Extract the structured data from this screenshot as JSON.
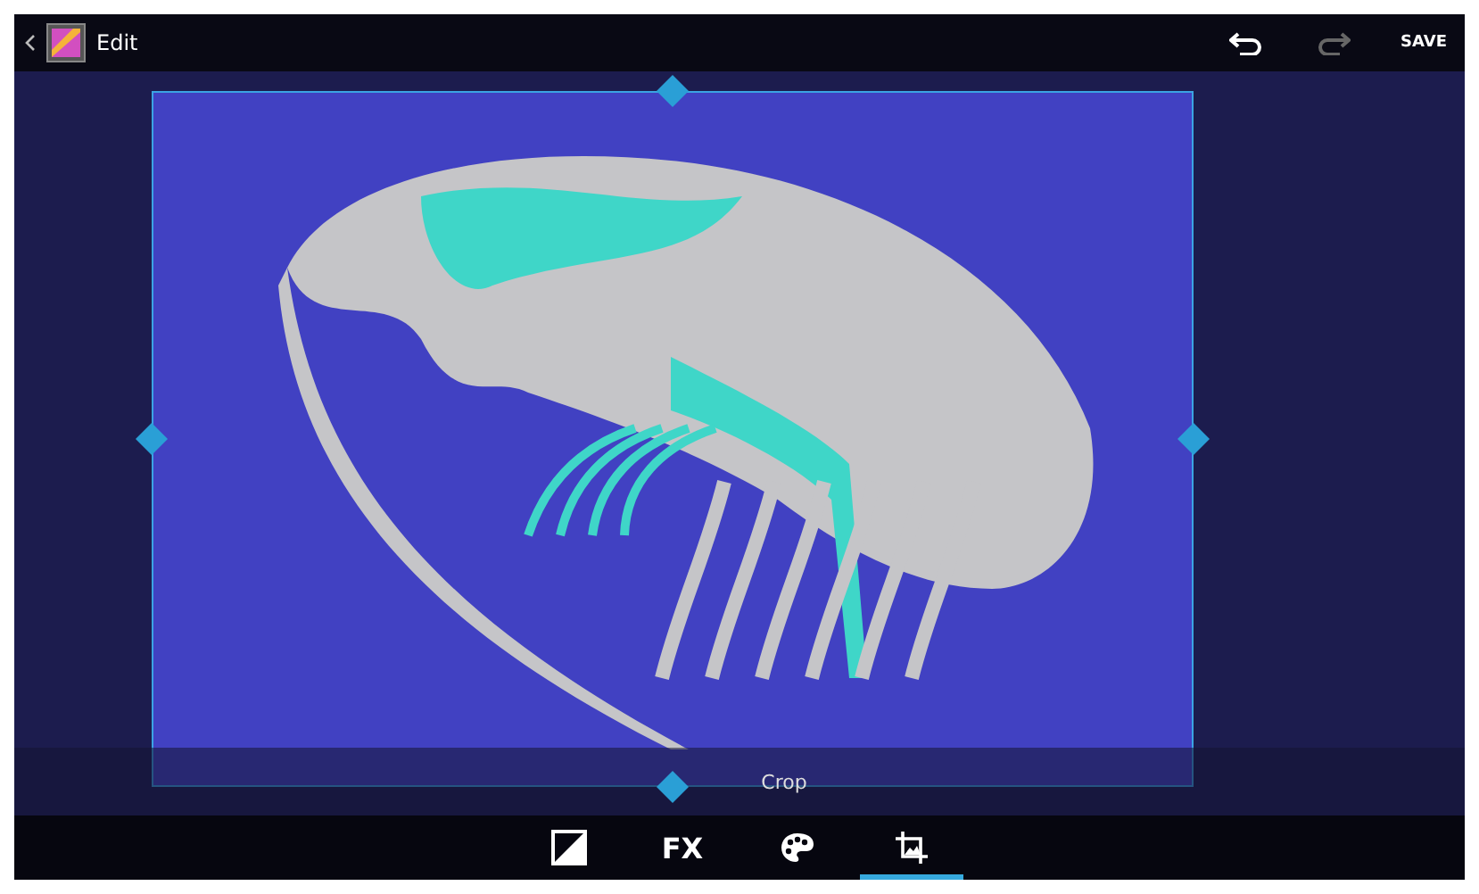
{
  "header": {
    "title": "Edit",
    "actions": [
      {
        "kind": "undo",
        "disabled": false
      },
      {
        "kind": "redo",
        "disabled": true
      },
      {
        "kind": "save",
        "label": "SAVE",
        "disabled": false
      }
    ]
  },
  "panel_label": "Crop",
  "tools": [
    {
      "kind": "exposure",
      "selected": false
    },
    {
      "kind": "fx",
      "label": "FX",
      "selected": false
    },
    {
      "kind": "colors",
      "selected": false
    },
    {
      "kind": "crop",
      "selected": true
    }
  ]
}
